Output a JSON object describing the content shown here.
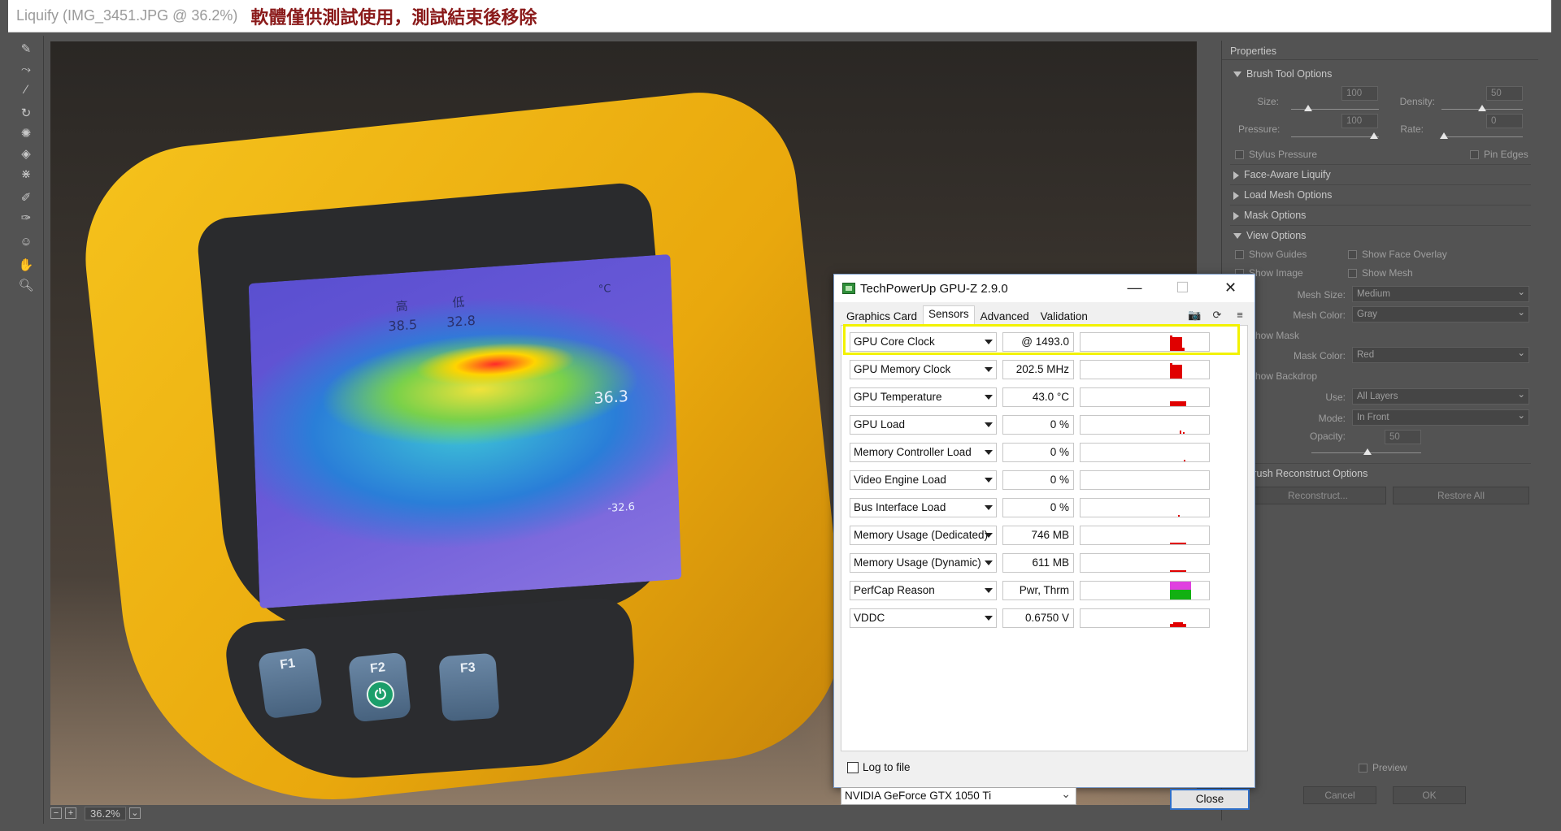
{
  "ps": {
    "title": "Liquify (IMG_3451.JPG @ 36.2%)",
    "notice": "軟體僅供測試使用，測試結束後移除",
    "zoom": "36.2%",
    "status_minus": "−",
    "status_plus": "+",
    "status_chevron": "⌄"
  },
  "photo": {
    "screen_labels": [
      "高",
      "低",
      "38.5",
      "32.8",
      "36.3",
      "-32.6",
      "°C"
    ],
    "buttons": [
      "F1",
      "F2",
      "F3"
    ],
    "power_glyph": "⏻"
  },
  "properties": {
    "header": "Properties",
    "brush_section": "Brush Tool Options",
    "size_label": "Size:",
    "size_value": "100",
    "density_label": "Density:",
    "density_value": "50",
    "pressure_label": "Pressure:",
    "pressure_value": "100",
    "rate_label": "Rate:",
    "rate_value": "0",
    "stylus_pressure": "Stylus Pressure",
    "pin_edges": "Pin Edges",
    "face_aware": "Face-Aware Liquify",
    "load_mesh": "Load Mesh Options",
    "mask_options": "Mask Options",
    "view_options": "View Options",
    "show_guides": "Show Guides",
    "show_face_overlay": "Show Face Overlay",
    "show_image": "Show Image",
    "show_mesh": "Show Mesh",
    "mesh_size_label": "Mesh Size:",
    "mesh_size_value": "Medium",
    "mesh_color_label": "Mesh Color:",
    "mesh_color_value": "Gray",
    "show_mask": "Show Mask",
    "mask_color_label": "Mask Color:",
    "mask_color_value": "Red",
    "show_backdrop": "Show Backdrop",
    "use_label": "Use:",
    "use_value": "All Layers",
    "mode_label": "Mode:",
    "mode_value": "In Front",
    "opacity_label": "Opacity:",
    "opacity_value": "50",
    "reconstruct_section": "Brush Reconstruct Options",
    "reconstruct_button": "Reconstruct...",
    "restore_all_button": "Restore All",
    "preview": "Preview",
    "cancel": "Cancel",
    "ok": "OK"
  },
  "gpuz": {
    "title": "TechPowerUp GPU-Z 2.9.0",
    "minimize_glyph": "—",
    "maximize_glyph": "☐",
    "close_glyph": "✕",
    "camera_glyph": "📷",
    "refresh_glyph": "⟳",
    "menu_glyph": "≡",
    "tabs": [
      "Graphics Card",
      "Sensors",
      "Advanced",
      "Validation"
    ],
    "active_tab": "Sensors",
    "sensors": [
      {
        "name": "GPU Core Clock",
        "value": "@ 1493.0"
      },
      {
        "name": "GPU Memory Clock",
        "value": "202.5 MHz"
      },
      {
        "name": "GPU Temperature",
        "value": "43.0 °C"
      },
      {
        "name": "GPU Load",
        "value": "0 %"
      },
      {
        "name": "Memory Controller Load",
        "value": "0 %"
      },
      {
        "name": "Video Engine Load",
        "value": "0 %"
      },
      {
        "name": "Bus Interface Load",
        "value": "0 %"
      },
      {
        "name": "Memory Usage (Dedicated)",
        "value": "746 MB"
      },
      {
        "name": "Memory Usage (Dynamic)",
        "value": "611 MB"
      },
      {
        "name": "PerfCap Reason",
        "value": "Pwr, Thrm"
      },
      {
        "name": "VDDC",
        "value": "0.6750 V"
      }
    ],
    "log_to_file": "Log to file",
    "gpu_select": "NVIDIA GeForce GTX 1050 Ti",
    "close_button": "Close"
  },
  "colors": {
    "graph_red": "#e00000",
    "perfcap_magenta": "#e040e0",
    "perfcap_green": "#12b012",
    "highlight": "#f2f200",
    "notice_red": "#8a1a1a"
  }
}
